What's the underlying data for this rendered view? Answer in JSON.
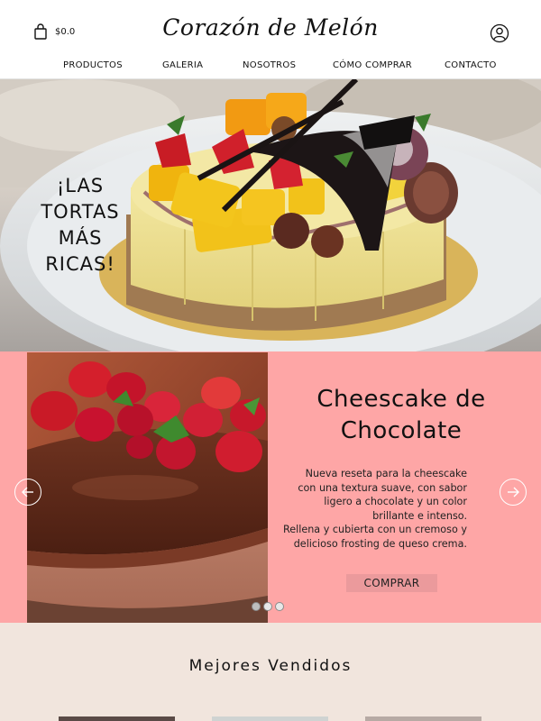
{
  "header": {
    "cart_total": "$0.0",
    "brand": "Corazón de Melón",
    "icons": {
      "cart": "shopping-bag-icon",
      "account": "user-circle-icon"
    }
  },
  "nav": {
    "items": [
      {
        "label": "PRODUCTOS"
      },
      {
        "label": "GALERIA"
      },
      {
        "label": "NOSOTROS"
      },
      {
        "label": "CÓMO COMPRAR"
      },
      {
        "label": "CONTACTO"
      }
    ]
  },
  "hero": {
    "slogan_lines": [
      "¡LAS",
      "TORTAS",
      "MÁS RICAS!"
    ]
  },
  "slider": {
    "title_lines": [
      "Cheescake de",
      "Chocolate"
    ],
    "description_lines": [
      "Nueva reseta para la cheescake",
      "con una textura suave, con sabor",
      "ligero a chocolate y un color",
      "brillante e intenso.",
      "Rellena y cubierta con un cremoso y",
      "delicioso frosting de queso crema."
    ],
    "button_label": "COMPRAR",
    "slide_count": 3,
    "active_slide": 1,
    "icons": {
      "prev": "arrow-left-icon",
      "next": "arrow-right-icon"
    }
  },
  "best_sellers": {
    "title": "Mejores Vendidos"
  },
  "colors": {
    "slider_bg": "#fea6a6",
    "button_bg": "#eb9a9c",
    "best_sellers_bg": "#f1e5dd",
    "header_bg": "#ffffff"
  }
}
